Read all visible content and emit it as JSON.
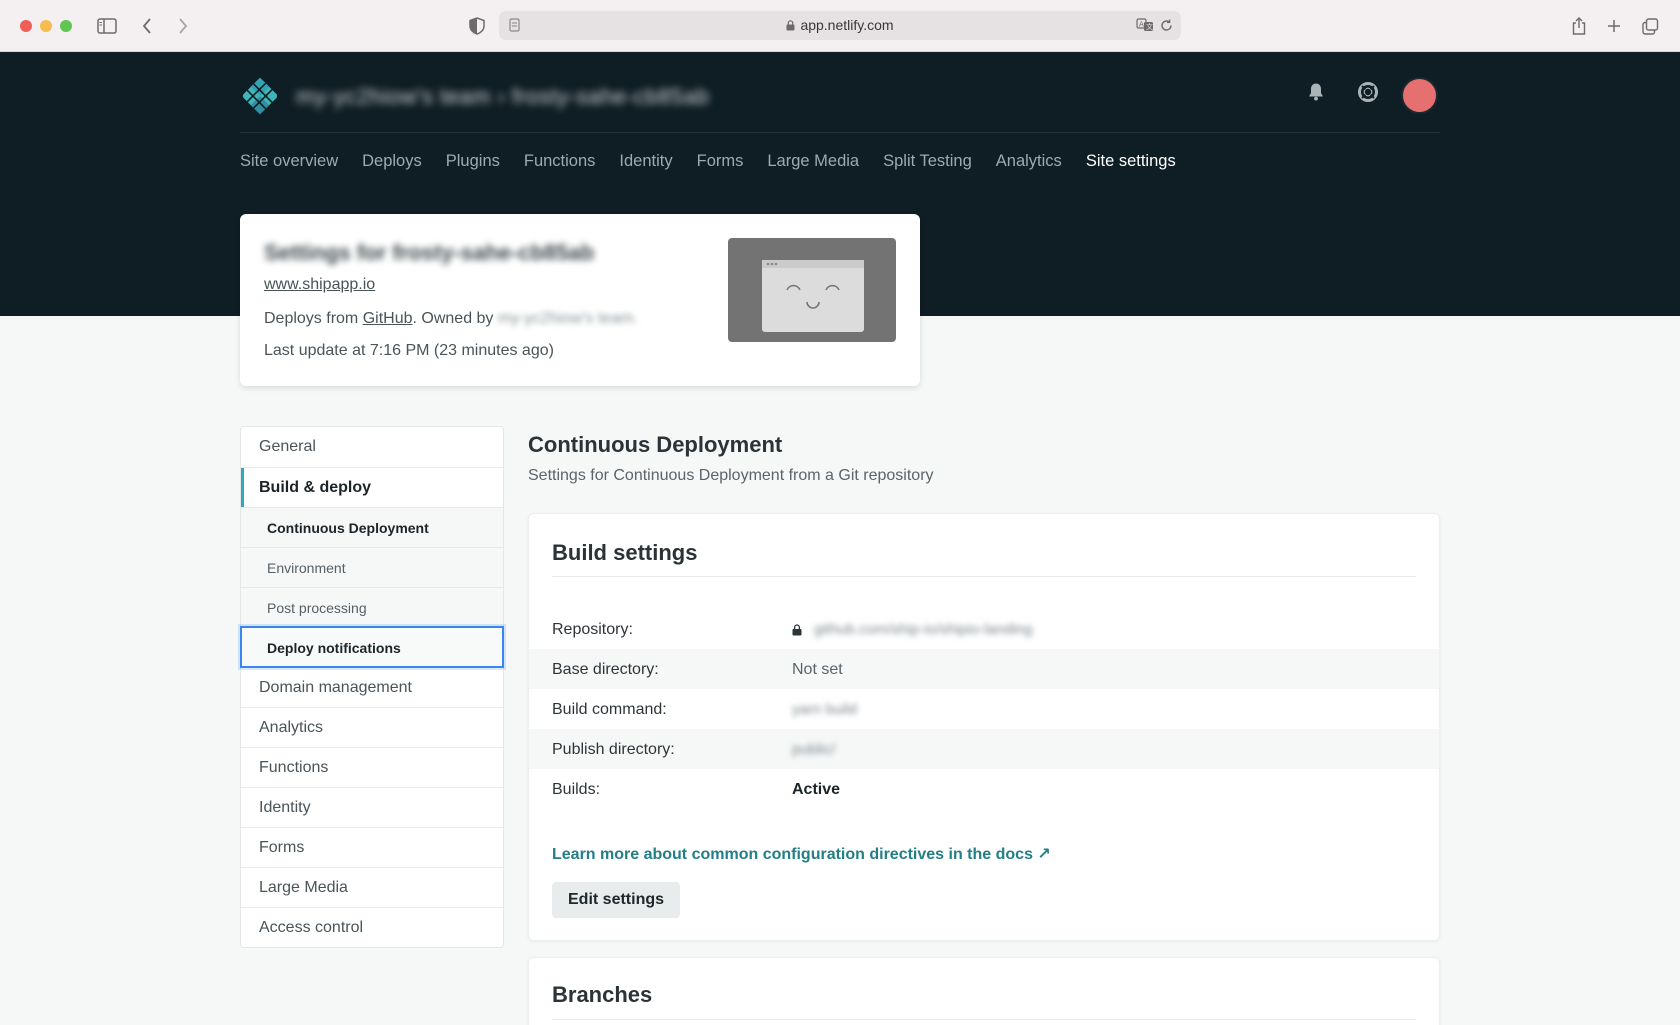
{
  "browser": {
    "url": "app.netlify.com"
  },
  "header": {
    "team_name": "my-yc2hiow's team  ›  frosty-sahe-cb85ab",
    "nav": [
      {
        "label": "Site overview"
      },
      {
        "label": "Deploys"
      },
      {
        "label": "Plugins"
      },
      {
        "label": "Functions"
      },
      {
        "label": "Identity"
      },
      {
        "label": "Forms"
      },
      {
        "label": "Large Media"
      },
      {
        "label": "Split Testing"
      },
      {
        "label": "Analytics"
      },
      {
        "label": "Site settings",
        "active": true
      }
    ]
  },
  "site_card": {
    "title": "Settings for frosty-sahe-cb85ab",
    "url": "www.shipapp.io",
    "deploys_prefix": "Deploys from",
    "deploys_source": "GitHub",
    "owned_by": ". Owned by",
    "owner": "my-yc2hiow's team.",
    "last_update": "Last update at 7:16 PM (23 minutes ago)"
  },
  "sidebar": {
    "items": [
      {
        "label": "General"
      },
      {
        "label": "Build & deploy",
        "active": true
      },
      {
        "label": "Domain management"
      },
      {
        "label": "Analytics"
      },
      {
        "label": "Functions"
      },
      {
        "label": "Identity"
      },
      {
        "label": "Forms"
      },
      {
        "label": "Large Media"
      },
      {
        "label": "Access control"
      }
    ],
    "sub_items": [
      {
        "label": "Continuous Deployment",
        "current": true
      },
      {
        "label": "Environment"
      },
      {
        "label": "Post processing"
      },
      {
        "label": "Deploy notifications",
        "focused": true
      }
    ]
  },
  "main": {
    "title": "Continuous Deployment",
    "subtitle": "Settings for Continuous Deployment from a Git repository",
    "build_settings": {
      "title": "Build settings",
      "rows": [
        {
          "key": "Repository:",
          "value": "github.com/ship-io/shipio-landing"
        },
        {
          "key": "Base directory:",
          "value": "Not set"
        },
        {
          "key": "Build command:",
          "value": "yarn build"
        },
        {
          "key": "Publish directory:",
          "value": "public/"
        },
        {
          "key": "Builds:",
          "value": "Active"
        }
      ],
      "docs_link": "Learn more about common configuration directives in the docs ↗",
      "edit_button": "Edit settings"
    },
    "branches": {
      "title": "Branches"
    }
  },
  "colors": {
    "header_bg": "#0f1d24",
    "accent_link": "#237f86",
    "sidebar_active_bar": "#30a8b7",
    "focus_ring": "#3a86f0",
    "avatar": "#e6706f"
  },
  "icons": [
    "sidebar-toggle-icon",
    "back-icon",
    "forward-icon",
    "shield-icon",
    "page-icon",
    "lock-icon",
    "translate-icon",
    "reload-icon",
    "share-icon",
    "new-tab-icon",
    "tabs-icon",
    "netlify-logo",
    "bell-icon",
    "help-icon"
  ]
}
